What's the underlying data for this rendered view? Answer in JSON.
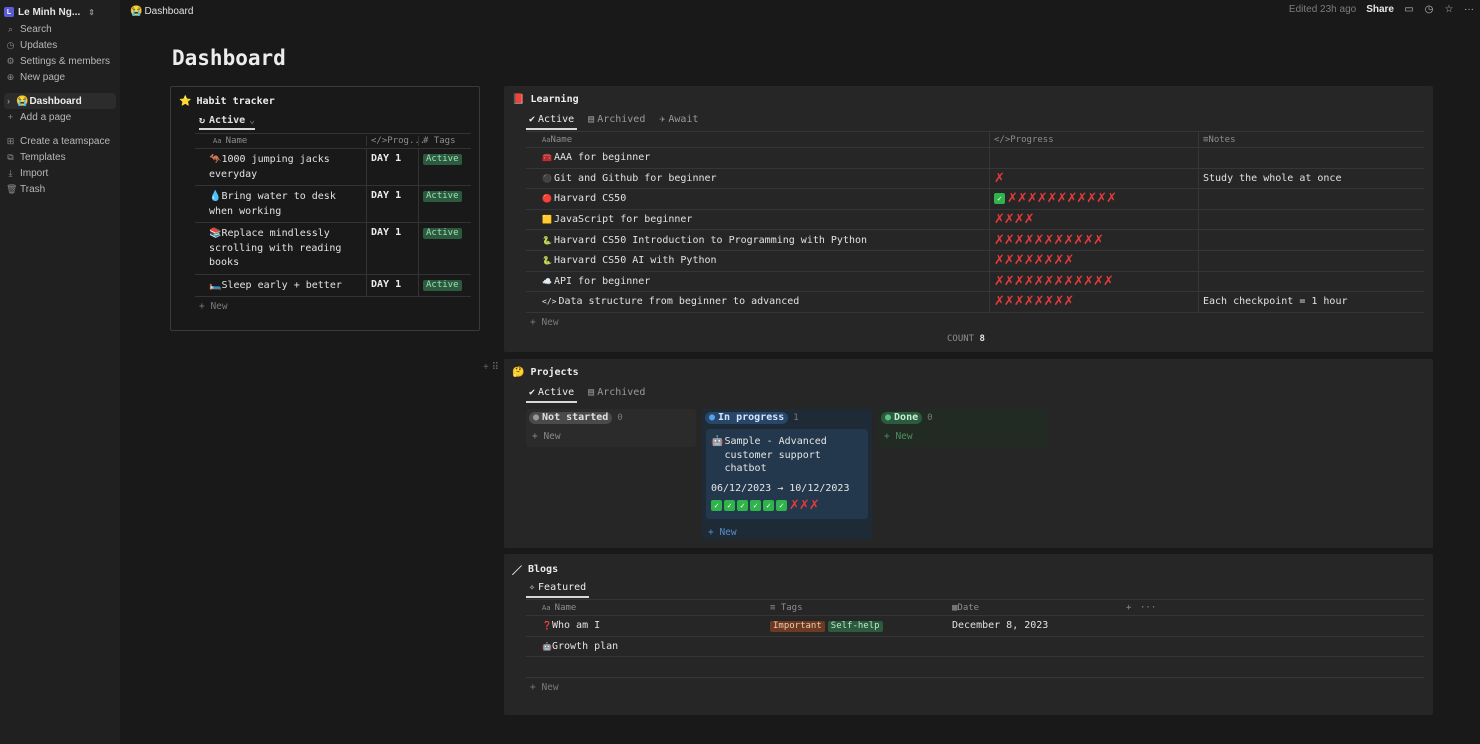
{
  "sidebar": {
    "workspace": "Le Minh Ng...",
    "workspace_initial": "L",
    "items": [
      {
        "label": "Search",
        "icon": "search-icon"
      },
      {
        "label": "Updates",
        "icon": "updates-icon"
      },
      {
        "label": "Settings & members",
        "icon": "gear-icon"
      },
      {
        "label": "New page",
        "icon": "plus-circle-icon"
      }
    ],
    "pages": [
      {
        "label": "Dashboard",
        "icon": "😭"
      },
      {
        "label": "Add a page",
        "icon": "plus-icon"
      }
    ],
    "bottom": [
      {
        "label": "Create a teamspace",
        "icon": "teamspace-icon"
      },
      {
        "label": "Templates",
        "icon": "templates-icon"
      },
      {
        "label": "Import",
        "icon": "import-icon"
      },
      {
        "label": "Trash",
        "icon": "trash-icon"
      }
    ]
  },
  "topbar": {
    "breadcrumb": "Dashboard",
    "breadcrumb_icon": "😭",
    "edited": "Edited 23h ago",
    "share": "Share"
  },
  "page": {
    "title": "Dashboard"
  },
  "habit": {
    "title": "Habit tracker",
    "icon": "⭐",
    "tab": "Active",
    "headers": {
      "name": "Name",
      "progress": "Prog...",
      "tags": "Tags"
    },
    "rows": [
      {
        "icon": "🦘",
        "name": "1000 jumping jacks everyday",
        "progress": "DAY 1",
        "tag": "Active"
      },
      {
        "icon": "💧",
        "name": "Bring water to desk when working",
        "progress": "DAY 1",
        "tag": "Active"
      },
      {
        "icon": "📚",
        "name": "Replace mindlessly scrolling with reading books",
        "progress": "DAY 1",
        "tag": "Active"
      },
      {
        "icon": "🛏️",
        "name": "Sleep early + better",
        "progress": "DAY 1",
        "tag": "Active"
      }
    ],
    "new": "+ New"
  },
  "learning": {
    "title": "Learning",
    "icon": "📕",
    "tabs": [
      "Active",
      "Archived",
      "Await"
    ],
    "headers": {
      "name": "Name",
      "progress": "Progress",
      "notes": "Notes"
    },
    "rows": [
      {
        "icon": "🧰",
        "name": "AAA for beginner",
        "checks": 0,
        "crosses": 0,
        "notes": ""
      },
      {
        "icon": "⚫",
        "name": "Git and Github for beginner",
        "checks": 0,
        "crosses": 1,
        "notes": "Study the whole at once"
      },
      {
        "icon": "🔴",
        "name": "Harvard CS50",
        "checks": 1,
        "crosses": 11,
        "notes": ""
      },
      {
        "icon": "🟨",
        "name": "JavaScript  for beginner",
        "checks": 0,
        "crosses": 4,
        "notes": ""
      },
      {
        "icon": "🐍",
        "name": "Harvard CS50 Introduction to Programming with Python",
        "checks": 0,
        "crosses": 11,
        "notes": ""
      },
      {
        "icon": "🐍",
        "name": "Harvard CS50 AI with Python",
        "checks": 0,
        "crosses": 8,
        "notes": ""
      },
      {
        "icon": "☁️",
        "name": "API for beginner",
        "checks": 0,
        "crosses": 12,
        "notes": ""
      },
      {
        "icon": "</>",
        "name": "Data structure from beginner to advanced",
        "checks": 0,
        "crosses": 8,
        "notes": "Each checkpoint = 1 hour"
      }
    ],
    "new": "+ New",
    "count_label": "COUNT",
    "count_value": "8"
  },
  "projects": {
    "title": "Projects",
    "icon": "🤔",
    "tabs": [
      "Active",
      "Archived"
    ],
    "columns": [
      {
        "label": "Not started",
        "count": "0",
        "new": "+ New"
      },
      {
        "label": "In progress",
        "count": "1",
        "new": "+ New"
      },
      {
        "label": "Done",
        "count": "0",
        "new": "+ New"
      }
    ],
    "card": {
      "icon": "🤖",
      "title": "Sample - Advanced customer support chatbot",
      "dates": "06/12/2023 → 10/12/2023",
      "checks": 6,
      "crosses": 3
    }
  },
  "blogs": {
    "title": "Blogs",
    "icon": "✏️",
    "tab": "Featured",
    "headers": {
      "name": "Name",
      "tags": "Tags",
      "date": "Date"
    },
    "rows": [
      {
        "icon": "❓",
        "name": "Who am I",
        "tags": [
          "Important",
          "Self-help"
        ],
        "date": "December 8, 2023"
      },
      {
        "icon": "🤖",
        "name": "Growth plan",
        "tags": [],
        "date": ""
      }
    ],
    "new": "+ New"
  },
  "colors": {
    "tag_green_bg": "#2b5a3e",
    "tag_orange_bg": "#6a3b22",
    "not_started_bg": "#4a4a4a",
    "in_progress_bg": "#27466a",
    "done_bg": "#2b5a3e",
    "cross": "#e23a3a",
    "check": "#2fb34a"
  }
}
